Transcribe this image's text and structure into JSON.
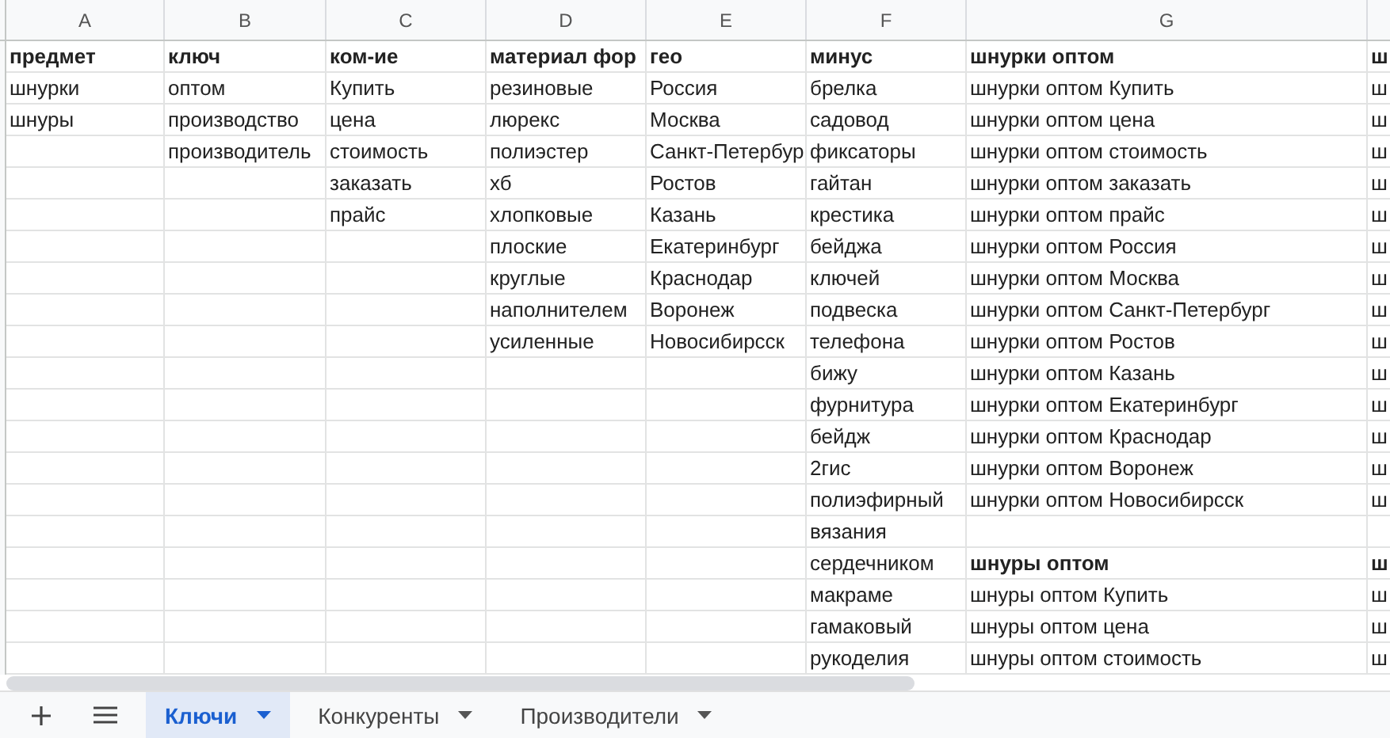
{
  "columns": [
    "A",
    "B",
    "C",
    "D",
    "E",
    "F",
    "G",
    null
  ],
  "rows": [
    [
      {
        "t": "предмет",
        "bold": true
      },
      {
        "t": "ключ",
        "bold": true
      },
      {
        "t": "ком-ие",
        "bold": true
      },
      {
        "t": "материал фор",
        "bold": true
      },
      {
        "t": "гео",
        "bold": true
      },
      {
        "t": "минус",
        "bold": true
      },
      {
        "t": "шнурки оптом",
        "bold": true
      },
      {
        "t": "ш",
        "bold": true
      }
    ],
    [
      {
        "t": "шнурки",
        "bold": false
      },
      {
        "t": "оптом",
        "bold": false
      },
      {
        "t": "Купить",
        "bold": false
      },
      {
        "t": "резиновые",
        "bold": false
      },
      {
        "t": "Россия",
        "bold": false
      },
      {
        "t": "брелка",
        "bold": false
      },
      {
        "t": "шнурки оптом Купить",
        "bold": false
      },
      {
        "t": "ш",
        "bold": false
      }
    ],
    [
      {
        "t": "шнуры",
        "bold": false
      },
      {
        "t": "производство",
        "bold": false
      },
      {
        "t": "цена",
        "bold": false
      },
      {
        "t": "люрекс",
        "bold": false
      },
      {
        "t": "Москва",
        "bold": false
      },
      {
        "t": "садовод",
        "bold": false
      },
      {
        "t": "шнурки оптом цена",
        "bold": false
      },
      {
        "t": "ш",
        "bold": false
      }
    ],
    [
      null,
      {
        "t": "производитель",
        "bold": false
      },
      {
        "t": "стоимость",
        "bold": false
      },
      {
        "t": "полиэстер",
        "bold": false
      },
      {
        "t": "Санкт-Петербур",
        "bold": false
      },
      {
        "t": "фиксаторы",
        "bold": false
      },
      {
        "t": "шнурки оптом стоимость",
        "bold": false
      },
      {
        "t": "ш",
        "bold": false
      }
    ],
    [
      null,
      null,
      {
        "t": "заказать",
        "bold": false
      },
      {
        "t": "хб",
        "bold": false
      },
      {
        "t": "Ростов",
        "bold": false
      },
      {
        "t": "гайтан",
        "bold": false
      },
      {
        "t": "шнурки оптом заказать",
        "bold": false
      },
      {
        "t": "ш",
        "bold": false
      }
    ],
    [
      null,
      null,
      {
        "t": "прайс",
        "bold": false
      },
      {
        "t": "хлопковые",
        "bold": false
      },
      {
        "t": "Казань",
        "bold": false
      },
      {
        "t": "крестика",
        "bold": false
      },
      {
        "t": "шнурки оптом прайс",
        "bold": false
      },
      {
        "t": "ш",
        "bold": false
      }
    ],
    [
      null,
      null,
      null,
      {
        "t": "плоские",
        "bold": false
      },
      {
        "t": "Екатеринбург",
        "bold": false
      },
      {
        "t": "бейджа",
        "bold": false
      },
      {
        "t": "шнурки оптом Россия",
        "bold": false
      },
      {
        "t": "ш",
        "bold": false
      }
    ],
    [
      null,
      null,
      null,
      {
        "t": "круглые",
        "bold": false
      },
      {
        "t": "Краснодар",
        "bold": false
      },
      {
        "t": "ключей",
        "bold": false
      },
      {
        "t": "шнурки оптом Москва",
        "bold": false
      },
      {
        "t": "ш",
        "bold": false
      }
    ],
    [
      null,
      null,
      null,
      {
        "t": "наполнителем",
        "bold": false
      },
      {
        "t": "Воронеж",
        "bold": false
      },
      {
        "t": "подвеска",
        "bold": false
      },
      {
        "t": "шнурки оптом Санкт-Петербург",
        "bold": false
      },
      {
        "t": "ш",
        "bold": false
      }
    ],
    [
      null,
      null,
      null,
      {
        "t": "усиленные",
        "bold": false
      },
      {
        "t": "Новосибирсск",
        "bold": false
      },
      {
        "t": "телефона",
        "bold": false
      },
      {
        "t": "шнурки оптом Ростов",
        "bold": false
      },
      {
        "t": "ш",
        "bold": false
      }
    ],
    [
      null,
      null,
      null,
      null,
      null,
      {
        "t": "бижу",
        "bold": false
      },
      {
        "t": "шнурки оптом Казань",
        "bold": false
      },
      {
        "t": "ш",
        "bold": false
      }
    ],
    [
      null,
      null,
      null,
      null,
      null,
      {
        "t": "фурнитура",
        "bold": false
      },
      {
        "t": "шнурки оптом Екатеринбург",
        "bold": false
      },
      {
        "t": "ш",
        "bold": false
      }
    ],
    [
      null,
      null,
      null,
      null,
      null,
      {
        "t": "бейдж",
        "bold": false
      },
      {
        "t": "шнурки оптом Краснодар",
        "bold": false
      },
      {
        "t": "ш",
        "bold": false
      }
    ],
    [
      null,
      null,
      null,
      null,
      null,
      {
        "t": "2гис",
        "bold": false
      },
      {
        "t": "шнурки оптом Воронеж",
        "bold": false
      },
      {
        "t": "ш",
        "bold": false
      }
    ],
    [
      null,
      null,
      null,
      null,
      null,
      {
        "t": "полиэфирный",
        "bold": false
      },
      {
        "t": "шнурки оптом Новосибирсск",
        "bold": false
      },
      {
        "t": "ш",
        "bold": false
      }
    ],
    [
      null,
      null,
      null,
      null,
      null,
      {
        "t": "вязания",
        "bold": false
      },
      null,
      null
    ],
    [
      null,
      null,
      null,
      null,
      null,
      {
        "t": "сердечником",
        "bold": false
      },
      {
        "t": "шнуры оптом",
        "bold": true
      },
      {
        "t": "ш",
        "bold": true
      }
    ],
    [
      null,
      null,
      null,
      null,
      null,
      {
        "t": "макраме",
        "bold": false
      },
      {
        "t": "шнуры оптом Купить",
        "bold": false
      },
      {
        "t": "ш",
        "bold": false
      }
    ],
    [
      null,
      null,
      null,
      null,
      null,
      {
        "t": "гамаковый",
        "bold": false
      },
      {
        "t": "шнуры оптом цена",
        "bold": false
      },
      {
        "t": "ш",
        "bold": false
      }
    ],
    [
      null,
      null,
      null,
      null,
      null,
      {
        "t": "рукоделия",
        "bold": false
      },
      {
        "t": "шнуры оптом стоимость",
        "bold": false
      },
      {
        "t": "ш",
        "bold": false
      }
    ]
  ],
  "sheet_tabs": [
    {
      "label": "Ключи",
      "selected": true
    },
    {
      "label": "Конкуренты",
      "selected": false
    },
    {
      "label": "Производители",
      "selected": false
    }
  ]
}
